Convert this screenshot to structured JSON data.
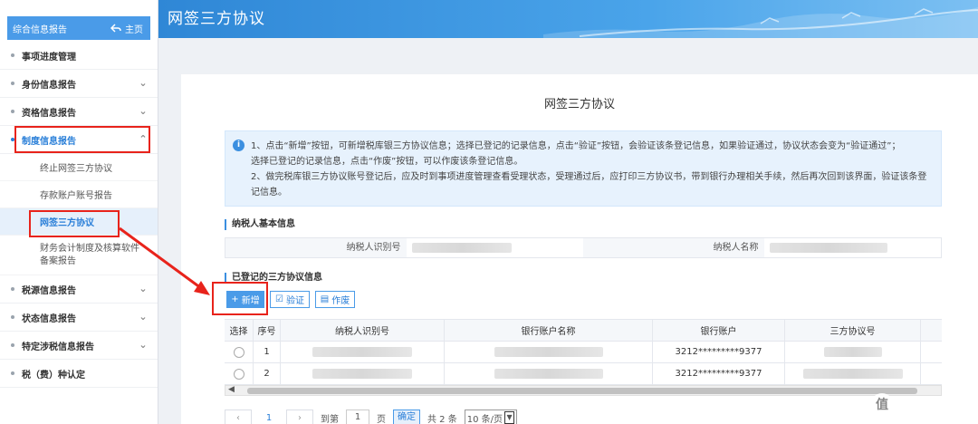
{
  "sidebar": {
    "header": {
      "title": "综合信息报告",
      "home": "主页"
    },
    "items": [
      {
        "label": "事项进度管理",
        "chevron": false
      },
      {
        "label": "身份信息报告",
        "chevron": true
      },
      {
        "label": "资格信息报告",
        "chevron": true
      },
      {
        "label": "制度信息报告",
        "chevron": true,
        "expanded": true
      },
      {
        "label": "税源信息报告",
        "chevron": true
      },
      {
        "label": "状态信息报告",
        "chevron": true
      },
      {
        "label": "特定涉税信息报告",
        "chevron": true
      },
      {
        "label": "税（费）种认定",
        "chevron": false
      }
    ],
    "subitems": [
      "终止网签三方协议",
      "存款账户账号报告",
      "网签三方协议",
      "财务会计制度及核算软件备案报告"
    ]
  },
  "banner": {
    "title": "网签三方协议"
  },
  "main": {
    "title": "网签三方协议",
    "notice": {
      "line1": "1、点击“新增”按钮，可新增税库银三方协议信息；选择已登记的记录信息，点击“验证”按钮，会验证该条登记信息，如果验证通过，协议状态会变为“验证通过”；",
      "line2": "选择已登记的记录信息，点击“作废”按钮，可以作废该条登记信息。",
      "line3": "2、做完税库银三方协议账号登记后，应及时到事项进度管理查看受理状态，受理通过后，应打印三方协议书，带到银行办理相关手续，然后再次回到该界面，验证该条登",
      "line4": "记信息。"
    },
    "taxpayer_section": "纳税人基本信息",
    "taxpayer_id_label": "纳税人识别号",
    "taxpayer_name_label": "纳税人名称",
    "registered_section": "已登记的三方协议信息",
    "buttons": {
      "add": "新增",
      "verify": "验证",
      "void": "作废"
    },
    "table": {
      "headers": [
        "选择",
        "序号",
        "纳税人识别号",
        "银行账户名称",
        "银行账户",
        "三方协议号"
      ],
      "rows": [
        {
          "index": "1",
          "account": "3212*********9377"
        },
        {
          "index": "2",
          "account": "3212*********9377"
        }
      ]
    },
    "pager": {
      "current": "1",
      "goto_label": "到第",
      "goto_value": "1",
      "page_unit": "页",
      "confirm": "确定",
      "total": "共 2 条",
      "page_size": "10 条/页"
    }
  },
  "watermark": "什么值得买",
  "colors": {
    "accent": "#4a9be8",
    "annotation": "#e8231b"
  }
}
